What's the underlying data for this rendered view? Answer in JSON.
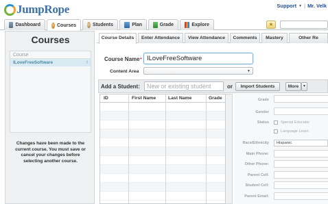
{
  "header": {
    "logo_text": "JumpRope",
    "support_label": "Support",
    "user_label": "Mr. Velk"
  },
  "nav": {
    "tabs": [
      {
        "label": "Dashboard",
        "icon": "dashboard-icon"
      },
      {
        "label": "Courses",
        "icon": "courses-icon",
        "active": true
      },
      {
        "label": "Students",
        "icon": "students-icon"
      },
      {
        "label": "Plan",
        "icon": "plan-icon"
      },
      {
        "label": "Grade",
        "icon": "grade-icon"
      },
      {
        "label": "Explore",
        "icon": "explore-icon"
      }
    ]
  },
  "sidebar": {
    "title": "Courses",
    "column_header": "Course",
    "courses": [
      {
        "name": "ILoveFreeSoftware",
        "mark": "!"
      }
    ],
    "message": "Changes have been made to the current course. You must save or cancel your changes before selecting another course."
  },
  "subtabs": [
    {
      "label": "Course Details",
      "active": true
    },
    {
      "label": "Enter Attendance"
    },
    {
      "label": "View Attendance"
    },
    {
      "label": "Comments"
    },
    {
      "label": "Mastery"
    },
    {
      "label": "Other Re"
    }
  ],
  "form": {
    "course_name_label": "Course Name",
    "required_marker": "•",
    "course_name_value": "ILoveFreeSoftware",
    "content_area_label": "Content Area",
    "content_area_value": ""
  },
  "add_student": {
    "label": "Add a Student:",
    "placeholder": "New or existing student",
    "or_label": "or",
    "import_label": "Import Students",
    "more_label": "More"
  },
  "table": {
    "columns": [
      "ID",
      "First Name",
      "Last Name",
      "Grade"
    ]
  },
  "details": {
    "grade_label": "Grade",
    "gender_label": "Gender",
    "status_label": "Status",
    "special_ed_label": "Special Educatio",
    "language_label": "Language Learn",
    "race_label": "Race/Ethnicity",
    "race_value": "Hispanic",
    "main_phone_label": "Main Phone:",
    "other_phone_label": "Other Phone:",
    "parent_cell_label": "Parent Cell:",
    "student_cell_label": "Student Cell:",
    "parent_email_label": "Parent Email:"
  },
  "colors": {
    "brand": "#3a6fa8",
    "link": "#1f4f9a",
    "focus": "#7fb3d5",
    "required": "#d13b2e"
  }
}
